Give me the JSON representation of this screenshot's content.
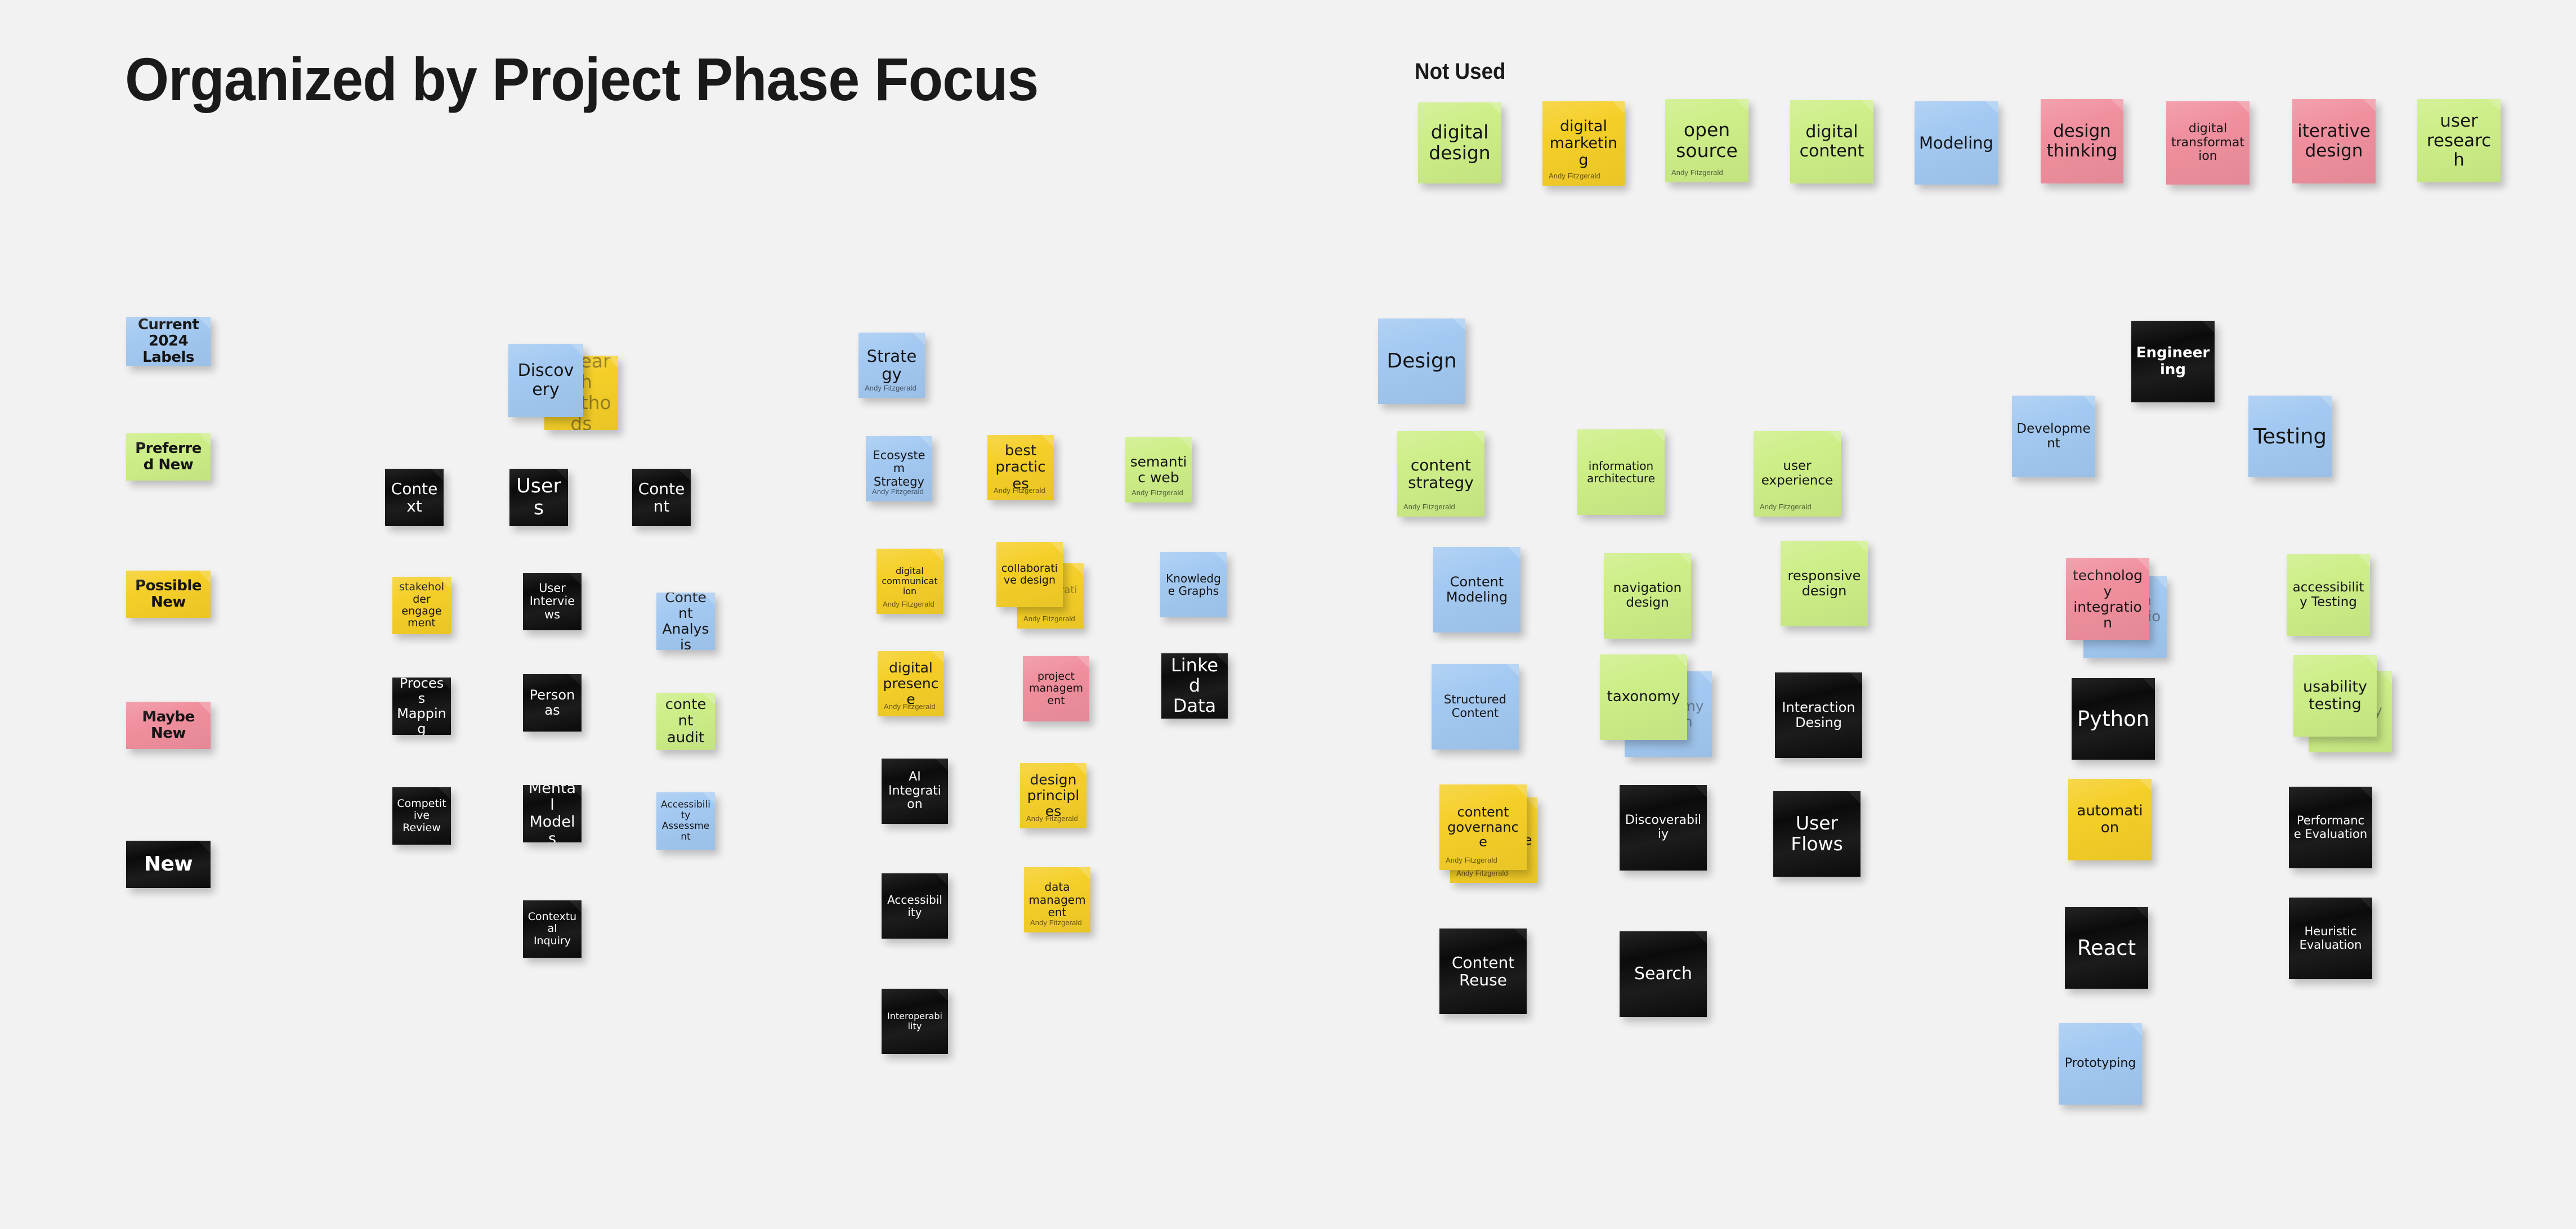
{
  "page": {
    "title": "Organized by Project Phase Focus",
    "background_color": "#f2f2f2",
    "author_label": "Andy Fitzgerald"
  },
  "palette": {
    "yellow": "#f5cf28",
    "green": "#cdee87",
    "blue": "#a3c9f2",
    "pink": "#f08f9e",
    "black": "#0b0b0b",
    "text_dark": "#141414",
    "text_light": "#ffffff"
  },
  "legend": {
    "key_label": "",
    "items": [
      {
        "label": "Current 2024 Labels",
        "color": "blue"
      },
      {
        "label": "Preferred New",
        "color": "green"
      },
      {
        "label": "Possible New",
        "color": "yellow"
      },
      {
        "label": "Maybe New",
        "color": "pink"
      },
      {
        "label": "New",
        "color": "black"
      }
    ]
  },
  "not_used": {
    "heading": "Not Used",
    "notes": [
      {
        "label": "digital design",
        "color": "green",
        "author": false
      },
      {
        "label": "digital marketing",
        "color": "yellow",
        "author": true
      },
      {
        "label": "open source",
        "color": "green",
        "author": true
      },
      {
        "label": "digital content",
        "color": "green",
        "author": false
      },
      {
        "label": "Modeling",
        "color": "blue",
        "author": false
      },
      {
        "label": "design thinking",
        "color": "pink",
        "author": false
      },
      {
        "label": "digital transformation",
        "color": "pink",
        "author": false
      },
      {
        "label": "iterative design",
        "color": "pink",
        "author": false
      },
      {
        "label": "user research",
        "color": "green",
        "author": false
      }
    ]
  },
  "clusters": [
    {
      "name": "Discovery",
      "header": {
        "label": "Discovery",
        "color": "blue"
      },
      "header_behind": {
        "label": "research methods",
        "color": "yellow"
      },
      "notes": [
        {
          "label": "Context",
          "color": "black"
        },
        {
          "label": "Users",
          "color": "black"
        },
        {
          "label": "Content",
          "color": "black"
        },
        {
          "label": "stakeholder engagement",
          "color": "yellow"
        },
        {
          "label": "User Interviews",
          "color": "black"
        },
        {
          "label": "Content Analysis",
          "color": "blue"
        },
        {
          "label": "Process Mapping",
          "color": "black"
        },
        {
          "label": "Personas",
          "color": "black"
        },
        {
          "label": "content audit",
          "color": "green"
        },
        {
          "label": "Competitive Review",
          "color": "black"
        },
        {
          "label": "Mental Models",
          "color": "black"
        },
        {
          "label": "Accessibility Assessment",
          "color": "blue"
        },
        {
          "label": "Contextual Inquiry",
          "color": "black"
        }
      ]
    },
    {
      "name": "Strategy",
      "header": {
        "label": "Strategy",
        "color": "blue"
      },
      "notes": [
        {
          "label": "Ecosystem Strategy",
          "color": "blue"
        },
        {
          "label": "best practices",
          "color": "yellow"
        },
        {
          "label": "semantic web",
          "color": "green"
        },
        {
          "label": "digital communication",
          "color": "yellow"
        },
        {
          "label": "collaborative design",
          "color": "yellow"
        },
        {
          "label": "collaboration",
          "color": "yellow"
        },
        {
          "label": "Knowledge Graphs",
          "color": "blue"
        },
        {
          "label": "digital presence",
          "color": "yellow"
        },
        {
          "label": "project management",
          "color": "pink"
        },
        {
          "label": "Linked Data",
          "color": "black"
        },
        {
          "label": "AI Integration",
          "color": "black"
        },
        {
          "label": "design principles",
          "color": "yellow"
        },
        {
          "label": "Accessibility",
          "color": "black"
        },
        {
          "label": "data management",
          "color": "yellow"
        },
        {
          "label": "Interoperability",
          "color": "black"
        }
      ]
    },
    {
      "name": "Design",
      "header": {
        "label": "Design",
        "color": "blue"
      },
      "notes": [
        {
          "label": "content strategy",
          "color": "green"
        },
        {
          "label": "information architecture",
          "color": "green"
        },
        {
          "label": "user experience",
          "color": "green"
        },
        {
          "label": "Content Modeling",
          "color": "blue"
        },
        {
          "label": "navigation design",
          "color": "green"
        },
        {
          "label": "responsive design",
          "color": "green"
        },
        {
          "label": "Structured Content",
          "color": "blue"
        },
        {
          "label": "taxonomy",
          "color": "green"
        },
        {
          "label": "Taxonomy Design",
          "color": "blue"
        },
        {
          "label": "Interaction Desing",
          "color": "black"
        },
        {
          "label": "content governance",
          "color": "yellow"
        },
        {
          "label": "content management",
          "color": "yellow"
        },
        {
          "label": "Discoverabiliy",
          "color": "black"
        },
        {
          "label": "User Flows",
          "color": "black"
        },
        {
          "label": "Content Reuse",
          "color": "black"
        },
        {
          "label": "Search",
          "color": "black"
        }
      ]
    },
    {
      "name": "Engineering",
      "header": {
        "label": "Engineering",
        "color": "black"
      },
      "notes": [
        {
          "label": "Development",
          "color": "blue"
        },
        {
          "label": "Testing",
          "color": "blue"
        },
        {
          "label": "technology integration",
          "color": "pink"
        },
        {
          "label": "system integration",
          "color": "blue"
        },
        {
          "label": "accessibility Testing",
          "color": "green"
        },
        {
          "label": "Python",
          "color": "black"
        },
        {
          "label": "usability testing",
          "color": "green"
        },
        {
          "label": "usability",
          "color": "green"
        },
        {
          "label": "automation",
          "color": "yellow"
        },
        {
          "label": "Performance Evaluation",
          "color": "black"
        },
        {
          "label": "React",
          "color": "black"
        },
        {
          "label": "Heuristic Evaluation",
          "color": "black"
        },
        {
          "label": "Prototyping",
          "color": "blue"
        }
      ]
    }
  ]
}
